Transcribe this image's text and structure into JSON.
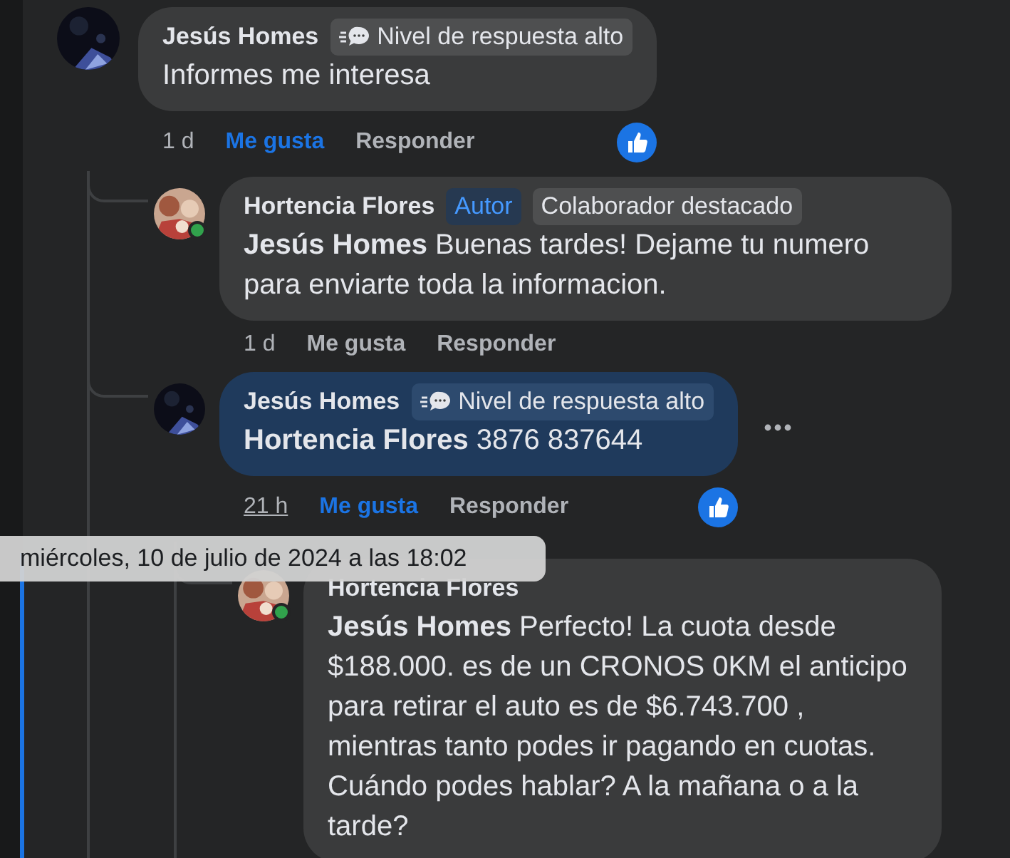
{
  "comments": [
    {
      "author": "Jesús Homes",
      "badges": [
        {
          "kind": "response",
          "label": "Nivel de respuesta alto"
        }
      ],
      "text": "Informes me interesa",
      "highlighted": false,
      "time": "1 d",
      "time_hovered": false,
      "like_label": "Me gusta",
      "liked": true,
      "reply_label": "Responder",
      "has_reaction": true,
      "children": [
        {
          "author": "Hortencia Flores",
          "online": true,
          "badges": [
            {
              "kind": "author",
              "label": "Autor"
            },
            {
              "kind": "contributor",
              "label": "Colaborador destacado"
            }
          ],
          "text": "**Jesús Homes** Buenas tardes! Dejame tu numero para enviarte toda la informacion.",
          "highlighted": false,
          "time": "1 d",
          "time_hovered": false,
          "like_label": "Me gusta",
          "liked": false,
          "reply_label": "Responder"
        },
        {
          "author": "Jesús Homes",
          "badges": [
            {
              "kind": "response",
              "label": "Nivel de respuesta alto"
            }
          ],
          "text": "**Hortencia Flores** 3876 837644",
          "highlighted": true,
          "time": "21 h",
          "time_hovered": true,
          "like_label": "Me gusta",
          "liked": true,
          "reply_label": "Responder",
          "has_reaction": true,
          "menu": true,
          "children": [
            {
              "author": "Hortencia Flores",
              "online": true,
              "text": "**Jesús Homes** Perfecto! La cuota desde $188.000. es de un CRONOS 0KM el anticipo para retirar el auto es de $6.743.700 , mientras tanto podes ir pagando en cuotas. Cuándo podes hablar? A la mañana o a la tarde?",
              "highlighted": false
            }
          ]
        }
      ]
    }
  ],
  "tooltip": {
    "text": "miércoles, 10 de julio de 2024 a las 18:02"
  }
}
